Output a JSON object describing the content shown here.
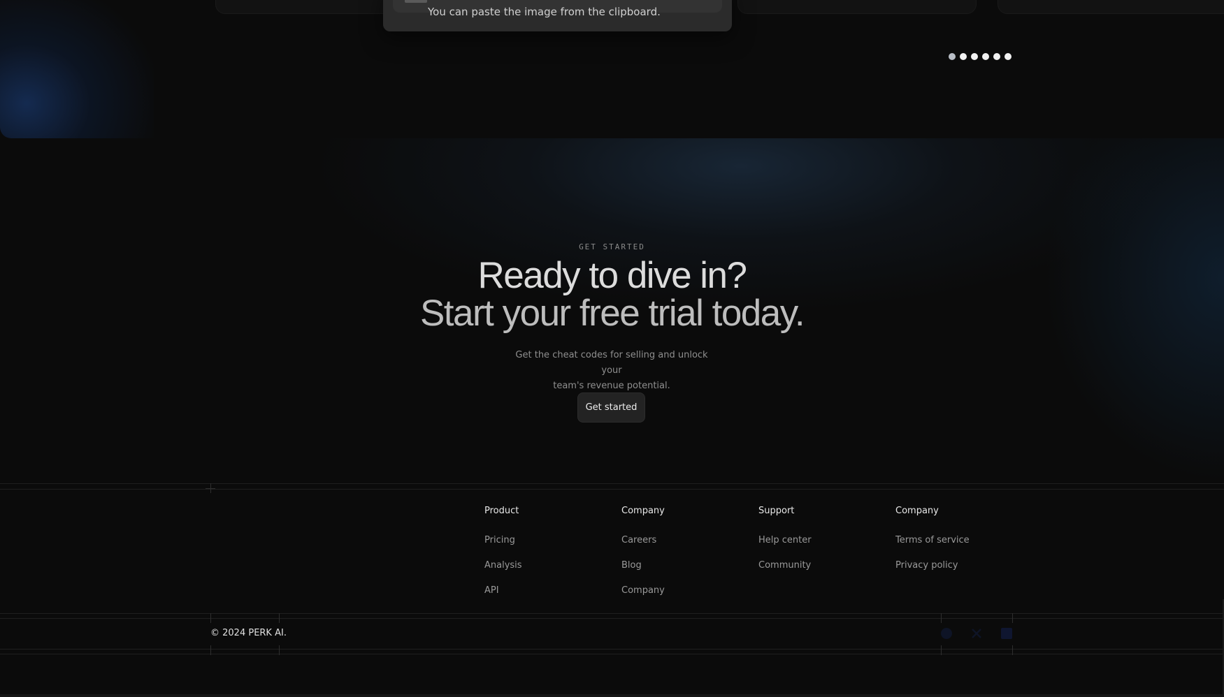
{
  "toast": {
    "message": "You can paste the image from the clipboard."
  },
  "carousel": {
    "dot_count": 6,
    "active_index": 0
  },
  "cta": {
    "eyebrow": "GET STARTED",
    "headline_line1": "Ready to dive in?",
    "headline_line2": "Start your free trial today.",
    "subtext_line1": "Get the cheat codes for selling and unlock your",
    "subtext_line2": "team's revenue potential.",
    "button_label": "Get started"
  },
  "footer": {
    "columns": [
      {
        "heading": "Product",
        "links": [
          "Pricing",
          "Analysis",
          "API"
        ]
      },
      {
        "heading": "Company",
        "links": [
          "Careers",
          "Blog",
          "Company"
        ]
      },
      {
        "heading": "Support",
        "links": [
          "Help center",
          "Community"
        ]
      },
      {
        "heading": "Company",
        "links": [
          "Terms of service",
          "Privacy policy"
        ]
      }
    ],
    "copyright": "© 2024 PERK AI.",
    "social_icons": [
      "facebook-icon",
      "twitter-icon",
      "linkedin-icon"
    ]
  },
  "colors": {
    "background": "#0b0b0b",
    "button_bg": "#232323",
    "glow_blue": "#16305c"
  }
}
